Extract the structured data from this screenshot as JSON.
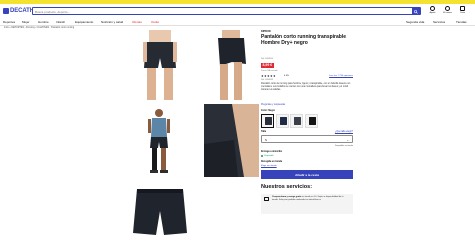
{
  "colors": {
    "brand": "#3643ba",
    "promo": "#f3e22f",
    "sale": "#e3262f",
    "available": "#149b65"
  },
  "header": {
    "logo_text": "DECATHLON",
    "search_placeholder": "Busca producto, deporte...",
    "icons": [
      {
        "name": "help-icon",
        "label": "Ayuda"
      },
      {
        "name": "account-icon",
        "label": "Mi cuenta"
      },
      {
        "name": "cart-icon",
        "label": "Cesta"
      }
    ]
  },
  "nav": {
    "items": [
      "Deportes",
      "Mujer",
      "Hombre",
      "Infantil",
      "Equipamiento",
      "Nutrición y salud",
      "Ofertas",
      "Outlet"
    ],
    "right_items": [
      "Segunda vida",
      "Servicios",
      "Tiendas"
    ]
  },
  "breadcrumb": "Inicio › DEPORTES › Running › CALZONES · Pantalón corto running",
  "product": {
    "brand": "KIPRUN",
    "title": "Pantalón corto running transpirable Hombre Dry+ negro",
    "ref_top": "Ref. 8494843",
    "price": "8,99 €",
    "tax_note": "Precio IVA incluido",
    "stars": "★★★★★",
    "rating": "4.5/5",
    "reviews_link": "Leer las 7 734 opiniones",
    "ref": "Ref. 8494843",
    "description": "Pantalón corto de running para hombre, ligero y transpirable, con un bolsillo trasero con cremallera. Los bolsillos se cierran con una cremallera para llevar tus llaves y el móvil durante tus salidas.",
    "qa_link": "Preguntas y respuestas",
    "color_label": "Color: Negro",
    "size_label": "Talla",
    "size_guide": "¿Qué talla elegir?",
    "size_value": "S",
    "stock_note": "Disponible en tienda",
    "delivery_label": "Entrega a domicilio",
    "availability": "Disponible",
    "pickup_label": "Recogida en tienda",
    "pickup_link": "Elegir una tienda",
    "add_button": "Añadir a la cesta",
    "services_title": "Nuestros servicios:",
    "service_text_bold": "Compra ahora y recoge gratis",
    "service_text": " en tienda en 1h. Sujeto a disponibilidad de la tienda. Solo para pedidos realizados en decathlon.es"
  }
}
